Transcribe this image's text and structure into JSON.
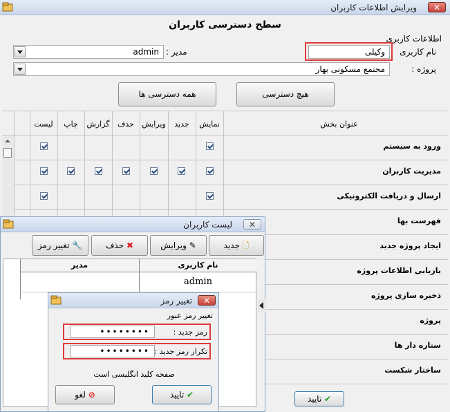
{
  "main_window": {
    "title": "ویرایش اطلاعات کاربران",
    "close": "✕",
    "heading": "سطح دسترسی کاربران",
    "group_label": "اطلاعات کاربری",
    "username_label": "نام کاربری",
    "username_value": "وکیلی",
    "manager_label": "مدیر :",
    "manager_value": "admin",
    "project_label": "پروژه :",
    "project_value": "مجتمع مسکونی بهار",
    "btn_no_access": "هیچ دسترسی",
    "btn_all_access": "همه دسترسی ها",
    "ok_button": "تایید"
  },
  "permissions": {
    "columns": [
      "عنوان بخش",
      "نمایش",
      "جدید",
      "ویرایش",
      "حذف",
      "گزارش",
      "چاپ",
      "لیست"
    ],
    "rows": [
      {
        "title": "ورود به سیستم"
      },
      {
        "title": "مدیریت کاربران"
      },
      {
        "title": "ارسال و دریافت الکترونیکی"
      },
      {
        "title": "فهرست بها"
      },
      {
        "title": "ایجاد پروژه جدید"
      },
      {
        "title": "بازیابی اطلاعات پروژه"
      },
      {
        "title": "ذخیره سازی پروژه"
      },
      {
        "title": "پروژه"
      },
      {
        "title": "ستاره دار ها"
      },
      {
        "title": "ساختار شکست"
      }
    ]
  },
  "users_window": {
    "title": "لیست کاربران",
    "close": "✕",
    "btn_new": "جدید",
    "btn_edit": "ویرایش",
    "btn_delete": "حذف",
    "btn_change_pass": "تغییر رمز",
    "col_username": "نام کاربری",
    "col_manager": "مدیر",
    "row_username": "admin"
  },
  "pass_window": {
    "title": "تغییر رمز",
    "close": "✕",
    "section": "تغییر رمز عبور",
    "new_label": "رمز جدید :",
    "new_value": "••••••••",
    "repeat_label": "تکرار رمز جدید :",
    "repeat_value": "••••••••",
    "keyboard_note": "صفحه کلید انگلیسی است",
    "ok": "تایید",
    "cancel": "لغو"
  }
}
